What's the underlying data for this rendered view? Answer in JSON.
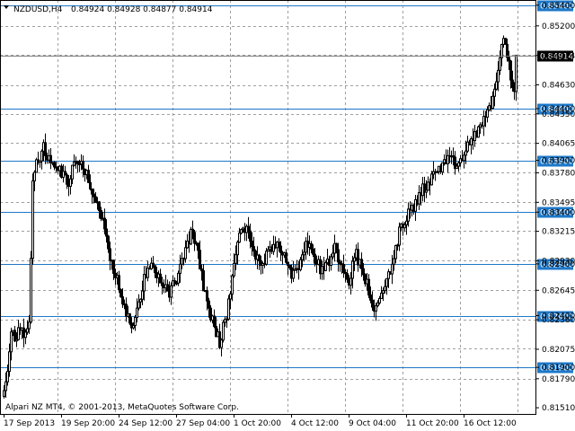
{
  "header": {
    "symbol_timeframe": "NZDUSD,H4",
    "ohlc": "0.84924 0.84928 0.84877 0.84914",
    "dropdown_icon": "triangle-down-icon"
  },
  "footer": {
    "copyright": "Alpari NZ MT4, © 2001-2013, MetaQuotes Software Corp."
  },
  "colors": {
    "level_line": "#1e78c8",
    "bid_tag": "#000000",
    "background": "#ffffff"
  },
  "chart_data": {
    "type": "candlestick",
    "symbol": "NZDUSD",
    "timeframe": "H4",
    "ylim": [
      0.8145,
      0.8545
    ],
    "grid": true,
    "y_ticks": [
      "0.85400",
      "0.85200",
      "0.84914",
      "0.84630",
      "0.84400",
      "0.84350",
      "0.84065",
      "0.83900",
      "0.83780",
      "0.83495",
      "0.83400",
      "0.83215",
      "0.82930",
      "0.82900",
      "0.82645",
      "0.82400",
      "0.82360",
      "0.82075",
      "0.81900",
      "0.81790",
      "0.81510"
    ],
    "x_ticks": [
      "17 Sep 2013",
      "19 Sep 20:00",
      "24 Sep 12:00",
      "27 Sep 04:00",
      "1 Oct 20:00",
      "4 Oct 12:00",
      "9 Oct 04:00",
      "11 Oct 20:00",
      "16 Oct 12:00"
    ],
    "levels": [
      "0.85400",
      "0.84400",
      "0.83900",
      "0.83400",
      "0.82900",
      "0.82400",
      "0.81900"
    ],
    "current_bid": "0.84914",
    "close_path": [
      [
        0,
        0.8162
      ],
      [
        2,
        0.8185
      ],
      [
        4,
        0.8225
      ],
      [
        6,
        0.8218
      ],
      [
        8,
        0.8225
      ],
      [
        10,
        0.8225
      ],
      [
        12,
        0.822
      ],
      [
        14,
        0.8235
      ],
      [
        15,
        0.829
      ],
      [
        16,
        0.8375
      ],
      [
        18,
        0.8385
      ],
      [
        20,
        0.8395
      ],
      [
        22,
        0.8405
      ],
      [
        24,
        0.8395
      ],
      [
        28,
        0.8382
      ],
      [
        32,
        0.8378
      ],
      [
        36,
        0.837
      ],
      [
        40,
        0.839
      ],
      [
        44,
        0.8385
      ],
      [
        48,
        0.8368
      ],
      [
        52,
        0.8345
      ],
      [
        56,
        0.8325
      ],
      [
        60,
        0.829
      ],
      [
        64,
        0.8268
      ],
      [
        68,
        0.8245
      ],
      [
        72,
        0.823
      ],
      [
        76,
        0.826
      ],
      [
        80,
        0.829
      ],
      [
        84,
        0.8285
      ],
      [
        88,
        0.827
      ],
      [
        92,
        0.8262
      ],
      [
        96,
        0.8275
      ],
      [
        100,
        0.83
      ],
      [
        104,
        0.832
      ],
      [
        108,
        0.83
      ],
      [
        112,
        0.826
      ],
      [
        116,
        0.8235
      ],
      [
        120,
        0.8215
      ],
      [
        124,
        0.824
      ],
      [
        128,
        0.829
      ],
      [
        132,
        0.8325
      ],
      [
        136,
        0.832
      ],
      [
        140,
        0.83
      ],
      [
        144,
        0.829
      ],
      [
        148,
        0.8305
      ],
      [
        152,
        0.831
      ],
      [
        156,
        0.83
      ],
      [
        160,
        0.828
      ],
      [
        164,
        0.829
      ],
      [
        168,
        0.831
      ],
      [
        172,
        0.83
      ],
      [
        176,
        0.8285
      ],
      [
        180,
        0.829
      ],
      [
        184,
        0.8305
      ],
      [
        188,
        0.829
      ],
      [
        192,
        0.8275
      ],
      [
        196,
        0.83
      ],
      [
        200,
        0.828
      ],
      [
        204,
        0.826
      ],
      [
        206,
        0.824
      ],
      [
        208,
        0.8248
      ],
      [
        212,
        0.827
      ],
      [
        216,
        0.829
      ],
      [
        220,
        0.832
      ],
      [
        224,
        0.8335
      ],
      [
        228,
        0.8345
      ],
      [
        232,
        0.836
      ],
      [
        236,
        0.8368
      ],
      [
        240,
        0.8378
      ],
      [
        244,
        0.8385
      ],
      [
        248,
        0.839
      ],
      [
        252,
        0.8385
      ],
      [
        256,
        0.8395
      ],
      [
        260,
        0.841
      ],
      [
        264,
        0.842
      ],
      [
        268,
        0.843
      ],
      [
        272,
        0.845
      ],
      [
        274,
        0.847
      ],
      [
        276,
        0.849
      ],
      [
        278,
        0.8505
      ],
      [
        280,
        0.8495
      ],
      [
        282,
        0.847
      ],
      [
        284,
        0.846
      ],
      [
        286,
        0.848
      ],
      [
        288,
        0.849
      ],
      [
        290,
        0.8491
      ]
    ]
  }
}
